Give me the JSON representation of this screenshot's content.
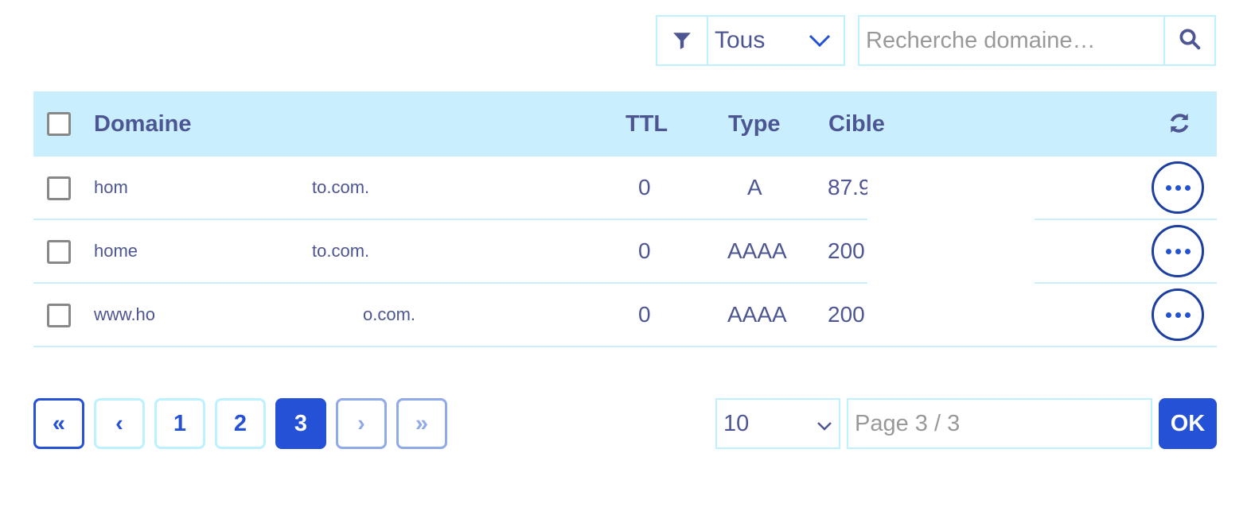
{
  "filter": {
    "selected": "Tous"
  },
  "search": {
    "placeholder": "Recherche domaine…"
  },
  "table": {
    "headers": {
      "domain": "Domaine",
      "ttl": "TTL",
      "type": "Type",
      "target": "Cible"
    },
    "rows": [
      {
        "domain_start": "hom",
        "domain_end": "to.com.",
        "ttl": "0",
        "type": "A",
        "target": "87.9"
      },
      {
        "domain_start": "home",
        "domain_end": "to.com.",
        "ttl": "0",
        "type": "AAAA",
        "target": "200"
      },
      {
        "domain_start": "www.ho",
        "domain_end": "o.com.",
        "ttl": "0",
        "type": "AAAA",
        "target": "200"
      }
    ]
  },
  "pagination": {
    "first": "«",
    "prev": "‹",
    "pages": [
      "1",
      "2",
      "3"
    ],
    "next": "›",
    "last": "»",
    "page_size": "10",
    "page_placeholder": "Page 3 / 3",
    "ok_label": "OK"
  }
}
